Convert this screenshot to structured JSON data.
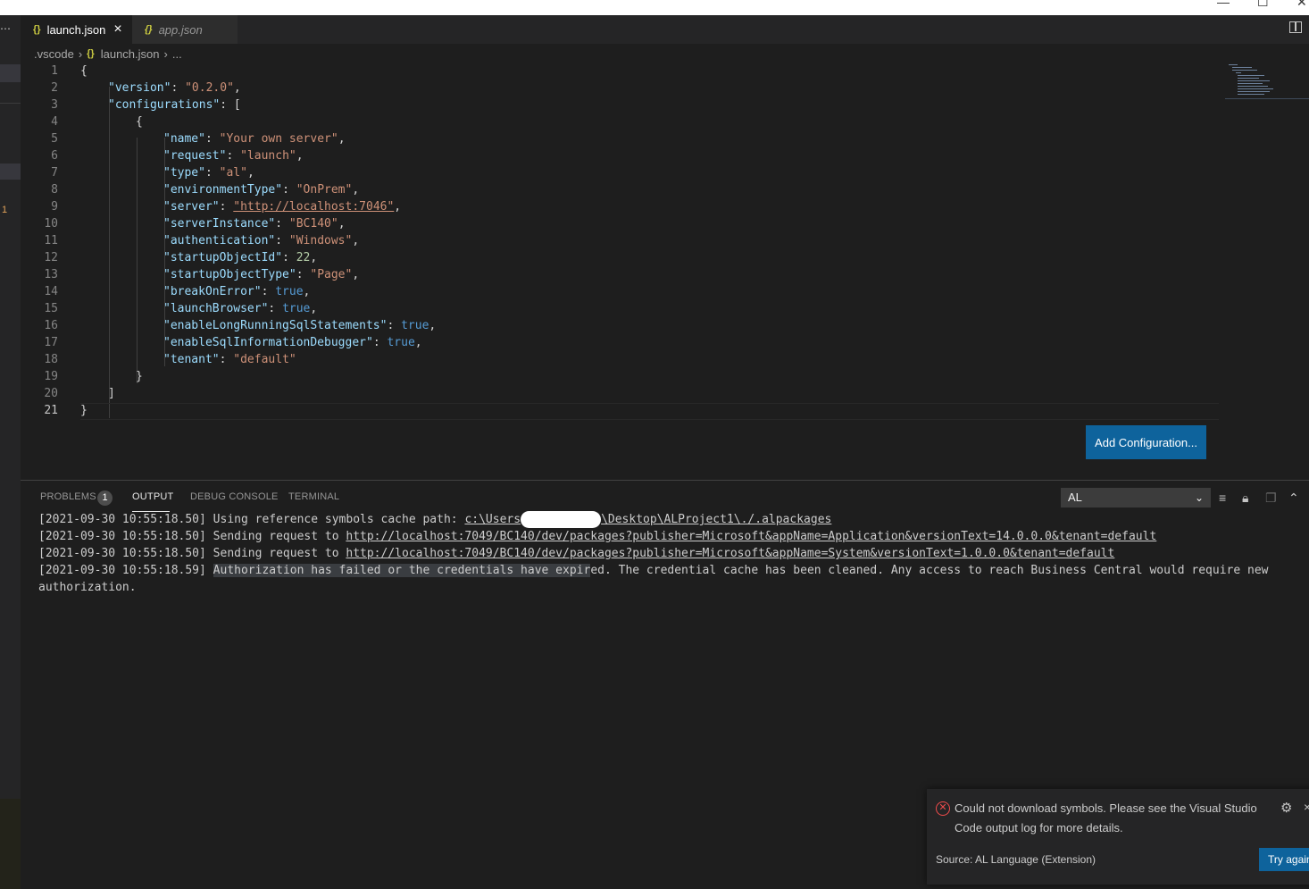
{
  "window": {
    "minimize": "—",
    "maximize": "☐",
    "close": "✕"
  },
  "tabs": [
    {
      "label": "launch.json",
      "active": true
    },
    {
      "label": "app.json",
      "active": false
    }
  ],
  "breadcrumb": {
    "folder": ".vscode",
    "file": "launch.json",
    "more": "..."
  },
  "sidebar": {
    "badge": "1"
  },
  "editor": {
    "line_numbers": [
      "1",
      "2",
      "3",
      "4",
      "5",
      "6",
      "7",
      "8",
      "9",
      "10",
      "11",
      "12",
      "13",
      "14",
      "15",
      "16",
      "17",
      "18",
      "19",
      "20",
      "21"
    ],
    "entries": [
      {
        "key": "\"name\"",
        "value": "\"Your own server\""
      },
      {
        "key": "\"request\"",
        "value": "\"launch\""
      },
      {
        "key": "\"type\"",
        "value": "\"al\""
      },
      {
        "key": "\"environmentType\"",
        "value": "\"OnPrem\""
      },
      {
        "key": "\"server\"",
        "value": "\"http://localhost:7046\""
      },
      {
        "key": "\"serverInstance\"",
        "value": "\"BC140\""
      },
      {
        "key": "\"authentication\"",
        "value": "\"Windows\""
      },
      {
        "key": "\"startupObjectId\"",
        "value": "22"
      },
      {
        "key": "\"startupObjectType\"",
        "value": "\"Page\""
      },
      {
        "key": "\"breakOnError\"",
        "value": "true"
      },
      {
        "key": "\"launchBrowser\"",
        "value": "true"
      },
      {
        "key": "\"enableLongRunningSqlStatements\"",
        "value": "true"
      },
      {
        "key": "\"enableSqlInformationDebugger\"",
        "value": "true"
      },
      {
        "key": "\"tenant\"",
        "value": "\"default\""
      }
    ],
    "version_key": "\"version\"",
    "version_value": "\"0.2.0\"",
    "configurations_key": "\"configurations\""
  },
  "add_configuration": "Add Configuration...",
  "panel": {
    "tabs": {
      "problems": "PROBLEMS",
      "output": "OUTPUT",
      "debug": "DEBUG CONSOLE",
      "terminal": "TERMINAL"
    },
    "problems_count": "1",
    "channel": "AL",
    "lines": {
      "l1_prefix": "[2021-09-30 10:55:18.50] Using reference symbols cache path: ",
      "l1_path_a": "c:\\Users",
      "l1_path_b": "\\Desktop\\ALProject1\\./.alpackages",
      "l2_prefix": "[2021-09-30 10:55:18.50] Sending request to ",
      "l2_url": "http://localhost:7049/BC140/dev/packages?publisher=Microsoft&appName=Application&versionText=14.0.0.0&tenant=default",
      "l3_prefix": "[2021-09-30 10:55:18.50] Sending request to ",
      "l3_url": "http://localhost:7049/BC140/dev/packages?publisher=Microsoft&appName=System&versionText=1.0.0.0&tenant=default",
      "l4_prefix": "[2021-09-30 10:55:18.59] ",
      "l4_hl": "Authorization has failed or the credentials have expir",
      "l4_rest": "ed. The credential cache has been cleaned. Any access to reach Business Central would require new",
      "l5": "authorization."
    }
  },
  "notification": {
    "message": "Could not download symbols. Please see the Visual Studio Code output log for more details.",
    "source": "Source: AL Language (Extension)",
    "button": "Try again"
  }
}
